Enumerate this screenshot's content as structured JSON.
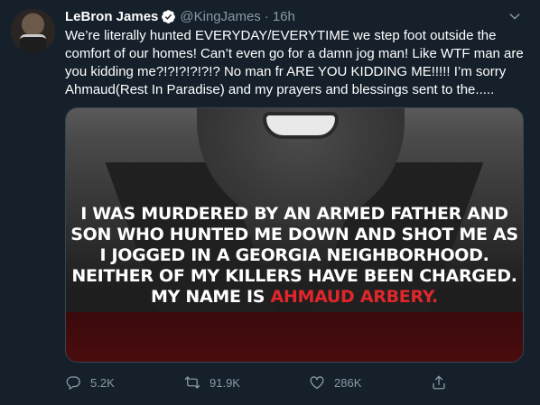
{
  "author": {
    "name": "LeBron James",
    "handle": "@KingJames",
    "time": "16h"
  },
  "tweet": {
    "text": "We’re literally hunted EVERYDAY/EVERYTIME we step foot outside the\ncomfort of our homes! Can’t even go for a damn jog man! Like WTF man are\nyou kidding me?!?!?!?!?!? No man fr ARE YOU KIDDING ME!!!!! I’m sorry\nAhmaud(Rest In Paradise) and my prayers and blessings sent to the....."
  },
  "image": {
    "caption_lines": [
      "I WAS MURDERED BY AN ARMED FATHER AND",
      "SON WHO HUNTED ME DOWN AND SHOT ME AS",
      "I JOGGED IN A GEORGIA NEIGHBORHOOD.",
      "NEITHER OF MY KILLERS HAVE BEEN CHARGED."
    ],
    "caption_last_prefix": "MY NAME IS ",
    "caption_last_name": "AHMAUD ARBERY."
  },
  "actions": {
    "replies": "5.2K",
    "retweets": "91.9K",
    "likes": "286K"
  },
  "colors": {
    "background": "#15202b",
    "secondary_text": "#8899a6",
    "verified": "#ffffff",
    "caption_red": "#e0262b"
  },
  "icons": [
    "verified-badge-icon",
    "chevron-down-icon",
    "reply-icon",
    "retweet-icon",
    "like-icon",
    "share-icon"
  ]
}
